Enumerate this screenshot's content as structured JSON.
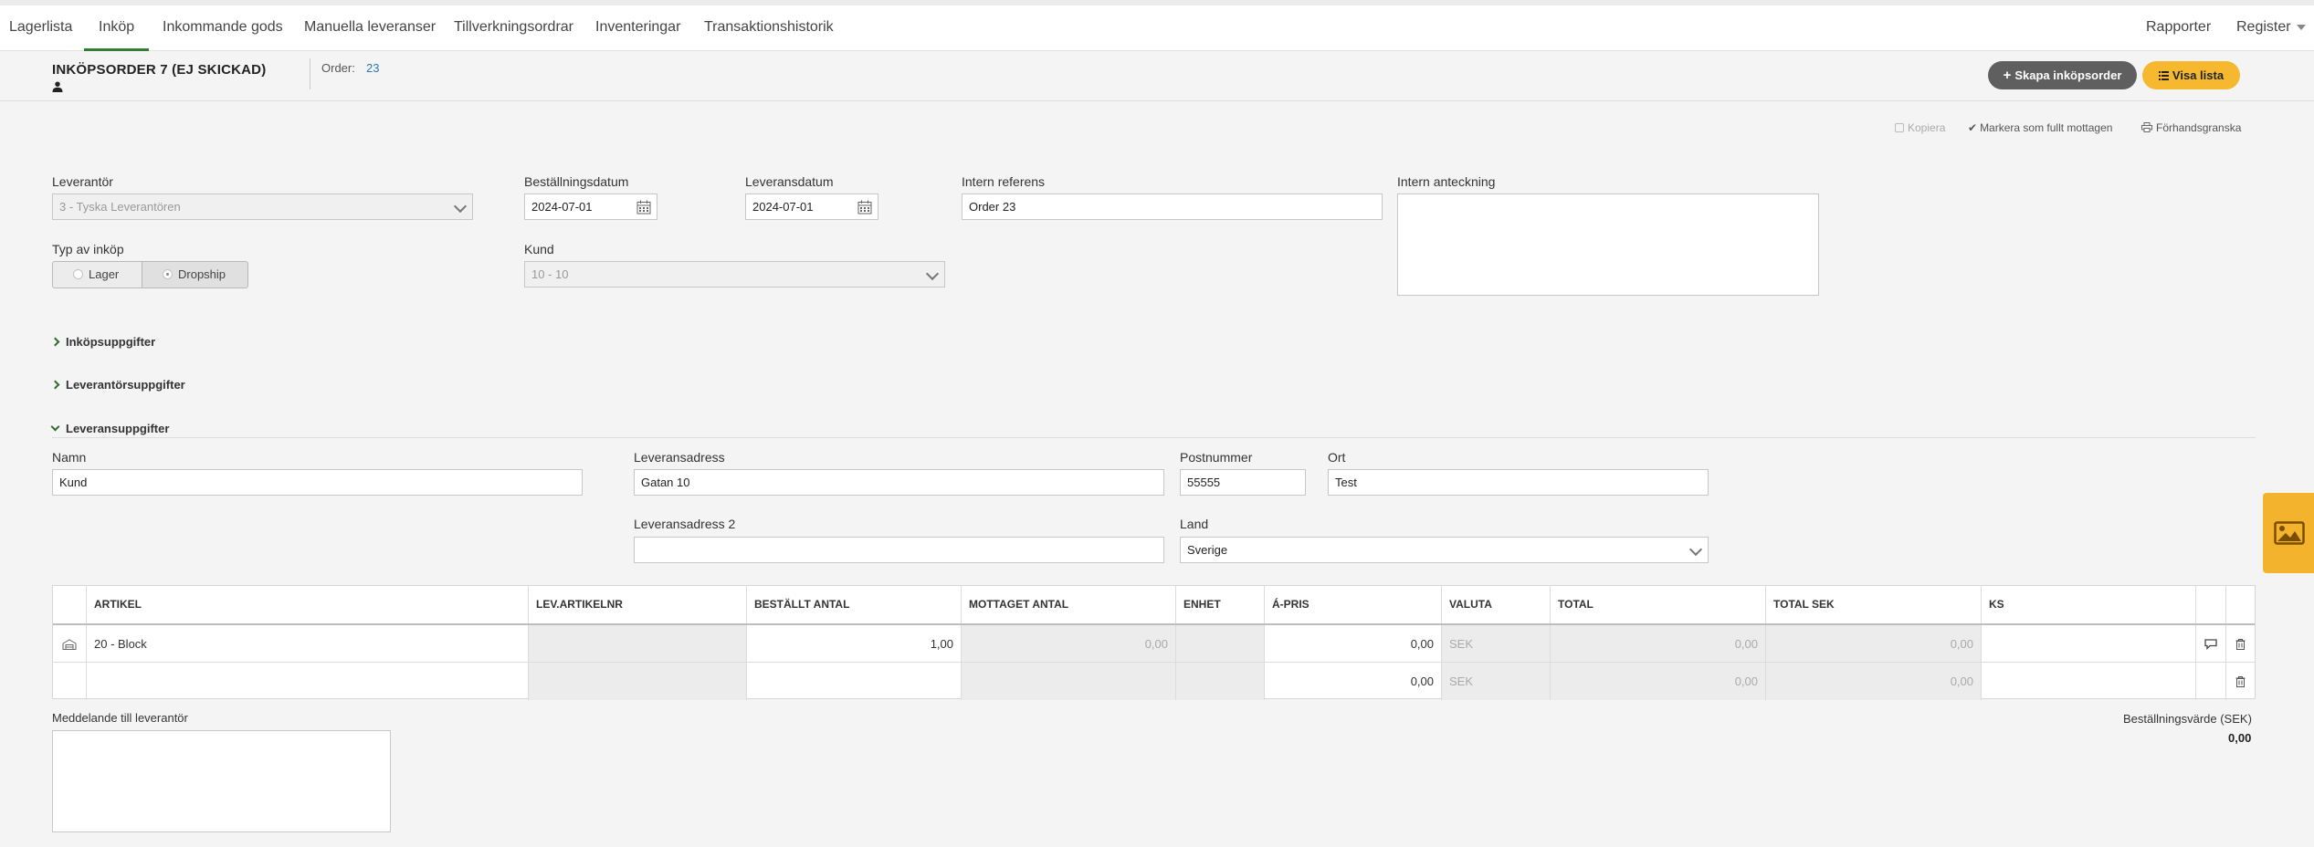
{
  "nav": {
    "items": [
      "Lagerlista",
      "Inköp",
      "Inkommande gods",
      "Manuella leveranser",
      "Tillverkningsordrar",
      "Inventeringar",
      "Transaktionshistorik"
    ],
    "active": "Inköp",
    "right": {
      "reports": "Rapporter",
      "register": "Register"
    }
  },
  "header": {
    "title": "INKÖPSORDER 7 (EJ SKICKAD)",
    "order_label": "Order:",
    "order_value": "23",
    "create_button": "Skapa inköpsorder",
    "list_button": "Visa lista"
  },
  "actions": {
    "copy": "Kopiera",
    "mark_received": "Markera som fullt mottagen",
    "preview": "Förhandsgranska"
  },
  "form": {
    "supplier_label": "Leverantör",
    "supplier_value": "3 - Tyska Leverantören",
    "order_date_label": "Beställningsdatum",
    "order_date_value": "2024-07-01",
    "delivery_date_label": "Leveransdatum",
    "delivery_date_value": "2024-07-01",
    "internal_ref_label": "Intern referens",
    "internal_ref_value": "Order 23",
    "internal_note_label": "Intern anteckning",
    "purchase_type_label": "Typ av inköp",
    "purchase_type_options": [
      "Lager",
      "Dropship"
    ],
    "purchase_type_selected": "Dropship",
    "customer_label": "Kund",
    "customer_value": "10 - 10"
  },
  "sections": {
    "purchase_details": "Inköpsuppgifter",
    "supplier_details": "Leverantörsuppgifter",
    "delivery_details": "Leveransuppgifter"
  },
  "delivery": {
    "name_label": "Namn",
    "name_value": "Kund",
    "address_label": "Leveransadress",
    "address_value": "Gatan 10",
    "postal_label": "Postnummer",
    "postal_value": "55555",
    "city_label": "Ort",
    "city_value": "Test",
    "address2_label": "Leveransadress 2",
    "address2_value": "",
    "country_label": "Land",
    "country_value": "Sverige"
  },
  "table": {
    "headers": [
      "ARTIKEL",
      "LEV.ARTIKELNR",
      "BESTÄLLT ANTAL",
      "MOTTAGET ANTAL",
      "ENHET",
      "Á-PRIS",
      "VALUTA",
      "TOTAL",
      "TOTAL SEK",
      "KS"
    ],
    "rows": [
      {
        "article": "20 - Block",
        "supplier_article_no": "",
        "ordered": "1,00",
        "received": "0,00",
        "unit": "",
        "unit_price": "0,00",
        "currency": "SEK",
        "total": "0,00",
        "total_sek": "0,00",
        "ks": ""
      },
      {
        "article": "",
        "supplier_article_no": "",
        "ordered": "",
        "received": "",
        "unit": "",
        "unit_price": "0,00",
        "currency": "SEK",
        "total": "0,00",
        "total_sek": "0,00",
        "ks": ""
      }
    ]
  },
  "footer": {
    "message_label": "Meddelande till leverantör",
    "order_value_label": "Beställningsvärde (SEK)",
    "order_value": "0,00"
  },
  "colors": {
    "accent_green": "#2f7d32",
    "link_blue": "#2a7ab8",
    "button_dark": "#5f5f5f",
    "button_yellow": "#f5b82e",
    "side_tab": "#f3b32c"
  }
}
